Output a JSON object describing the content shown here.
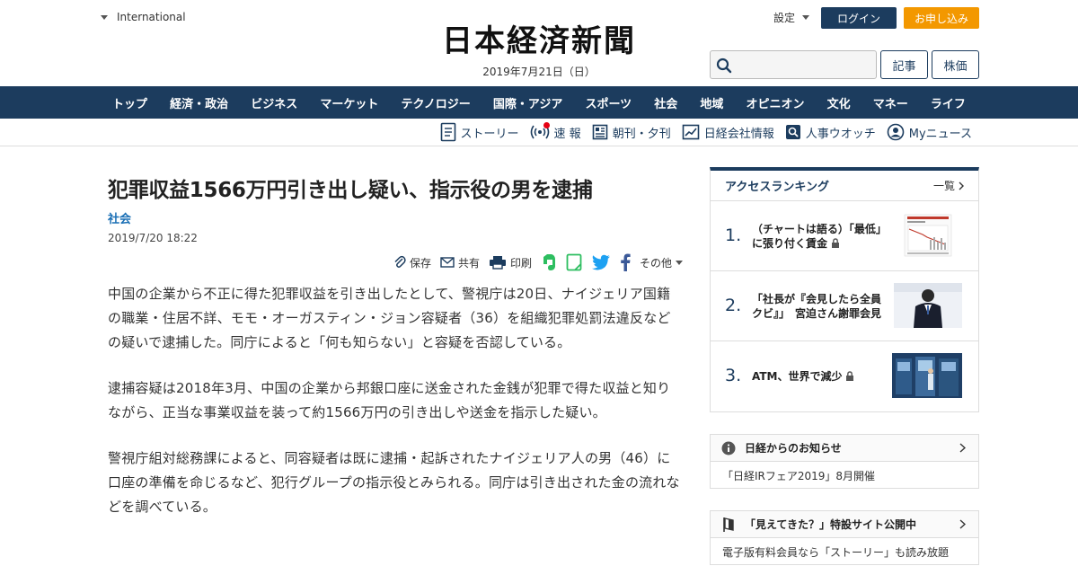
{
  "header": {
    "international": "International",
    "logo": "日本経済新聞",
    "date": "2019年7月21日（日）",
    "settings": "設定",
    "login": "ログイン",
    "apply": "お申し込み",
    "search_placeholder": "",
    "articles": "記事",
    "stocks": "株価"
  },
  "nav": [
    "トップ",
    "経済・政治",
    "ビジネス",
    "マーケット",
    "テクノロジー",
    "国際・アジア",
    "スポーツ",
    "社会",
    "地域",
    "オピニオン",
    "文化",
    "マネー",
    "ライフ"
  ],
  "subnav": {
    "story": "ストーリー",
    "breaking": "速 報",
    "editions": "朝刊・夕刊",
    "company": "日経会社情報",
    "people": "人事ウオッチ",
    "mynews": "Myニュース"
  },
  "article": {
    "title": "犯罪収益1566万円引き出し疑い、指示役の男を逮捕",
    "category": "社会",
    "published": "2019/7/20 18:22",
    "share": {
      "save": "保存",
      "share": "共有",
      "print": "印刷",
      "other": "その他"
    },
    "paragraphs": [
      "中国の企業から不正に得た犯罪収益を引き出したとして、警視庁は20日、ナイジェリア国籍の職業・住居不詳、モモ・オーガスティン・ジョン容疑者（36）を組織犯罪処罰法違反などの疑いで逮捕した。同庁によると「何も知らない」と容疑を否認している。",
      "逮捕容疑は2018年3月、中国の企業から邦銀口座に送金された金銭が犯罪で得た収益と知りながら、正当な事業収益を装って約1566万円の引き出しや送金を指示した疑い。",
      "警視庁組対総務課によると、同容疑者は既に逮捕・起訴されたナイジェリア人の男（46）に口座の準備を命じるなど、犯行グループの指示役とみられる。同庁は引き出された金の流れなどを調べている。"
    ]
  },
  "ranking": {
    "title": "アクセスランキング",
    "more": "一覧",
    "items": [
      {
        "no": "1.",
        "text": "（チャートは語る）「最低」に張り付く賃金"
      },
      {
        "no": "2.",
        "text": "「社長が『会見したら全員クビ』」　宮迫さん謝罪会見"
      },
      {
        "no": "3.",
        "text": "ATM、世界で減少"
      }
    ]
  },
  "notice": {
    "title": "日経からのお知らせ",
    "body": "「日経IRフェア2019」8月開催"
  },
  "promo": {
    "title": "「見えてきた？」特設サイト公開中",
    "body": "電子版有料会員なら「ストーリー」も読み放題"
  },
  "colors": {
    "navy": "#1c3c5e",
    "orange": "#f39800",
    "link_blue": "#1a6fb5",
    "evernote_green": "#2dbe60",
    "twitter_blue": "#1da1f2",
    "facebook_blue": "#3b5998"
  }
}
